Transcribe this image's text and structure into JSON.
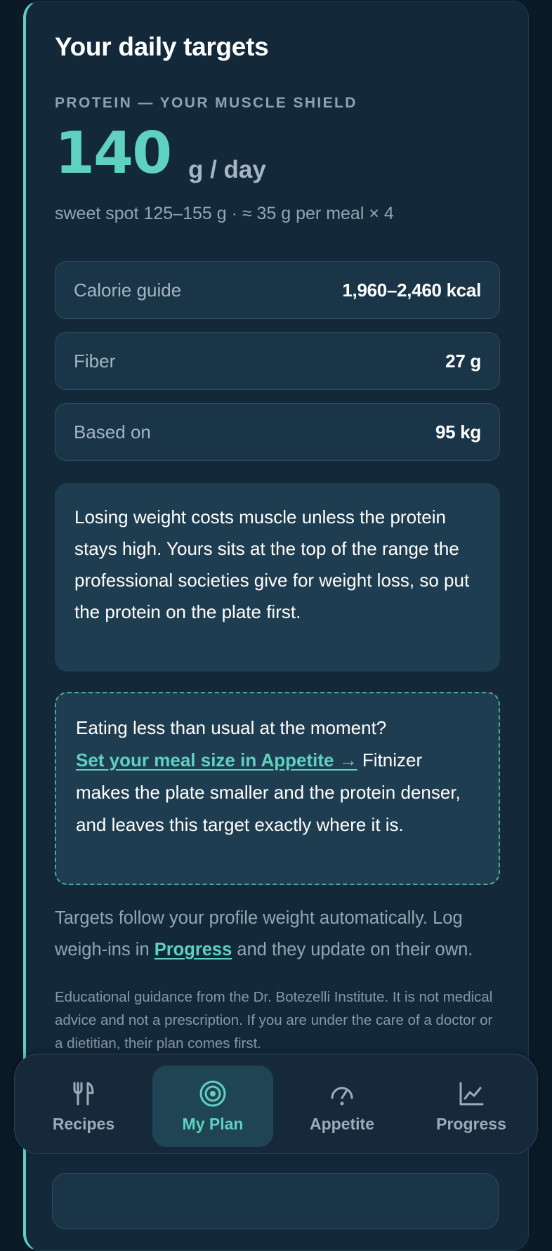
{
  "targets": {
    "title": "Your daily targets",
    "eyebrow": "PROTEIN — YOUR MUSCLE SHIELD",
    "protein_value": "140",
    "protein_unit": "g / day",
    "sweet_spot": "sweet spot 125–155 g · ≈ 35 g per meal × 4",
    "stats": [
      {
        "label": "Calorie guide",
        "value": "1,960–2,460 kcal"
      },
      {
        "label": "Fiber",
        "value": "27 g"
      },
      {
        "label": "Based on",
        "value": "95 kg"
      }
    ],
    "explanation": "Losing weight costs muscle unless the protein stays high. Yours sits at the top of the range the professional societies give for weight loss, so put the protein on the plate first.",
    "appetite": {
      "lead": "Eating less than usual at the moment?",
      "link": "Set your meal size in Appetite →",
      "rest": " Fitnizer makes the plate smaller and the protein denser, and leaves this target exactly where it is."
    },
    "follow": {
      "before": "Targets follow your profile weight automatically. Log weigh-ins in ",
      "link": "Progress",
      "after": " and they update on their own."
    },
    "disclaimer": "Educational guidance from the Dr. Botezelli Institute. It is not medical advice and not a prescription. If you are under the care of a doctor or a dietitian, their plan comes first."
  },
  "nav": {
    "items": [
      {
        "label": "Recipes",
        "icon": "fork-knife-icon",
        "active": false
      },
      {
        "label": "My Plan",
        "icon": "target-icon",
        "active": true
      },
      {
        "label": "Appetite",
        "icon": "gauge-icon",
        "active": false
      },
      {
        "label": "Progress",
        "icon": "chart-line-icon",
        "active": false
      }
    ]
  },
  "colors": {
    "accent": "#5fd1c0",
    "background": "#0b1a27",
    "card": "#13293a"
  }
}
